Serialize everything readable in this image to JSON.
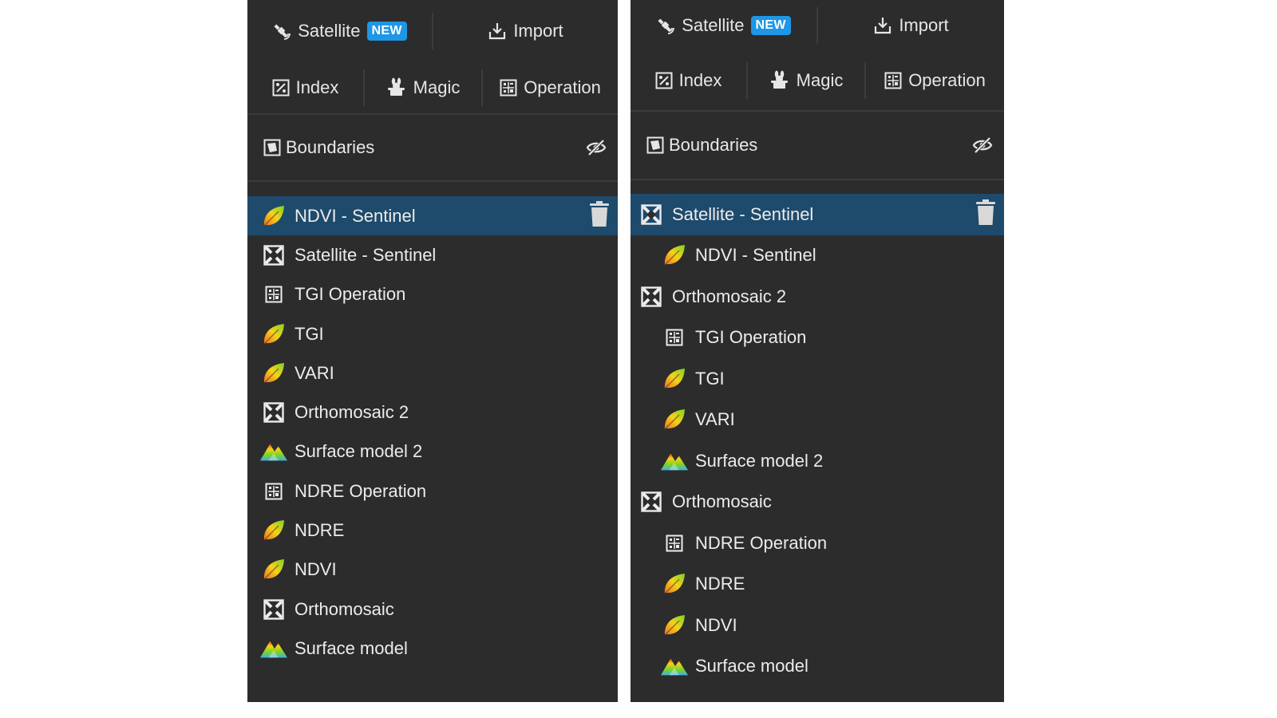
{
  "toolbar": {
    "satellite_label": "Satellite",
    "new_badge": "NEW",
    "import_label": "Import",
    "index_label": "Index",
    "magic_label": "Magic",
    "operation_label": "Operation"
  },
  "boundaries_label": "Boundaries",
  "left_layers": [
    {
      "label": "NDVI - Sentinel",
      "icon": "leaf-icon",
      "selected": true
    },
    {
      "label": "Satellite - Sentinel",
      "icon": "imagery-icon"
    },
    {
      "label": "TGI Operation",
      "icon": "operation-icon"
    },
    {
      "label": "TGI",
      "icon": "leaf-icon"
    },
    {
      "label": "VARI",
      "icon": "leaf-icon"
    },
    {
      "label": "Orthomosaic 2",
      "icon": "imagery-icon"
    },
    {
      "label": "Surface model 2",
      "icon": "mountain-icon"
    },
    {
      "label": "NDRE Operation",
      "icon": "operation-icon"
    },
    {
      "label": "NDRE",
      "icon": "leaf-icon"
    },
    {
      "label": "NDVI",
      "icon": "leaf-icon"
    },
    {
      "label": "Orthomosaic",
      "icon": "imagery-icon"
    },
    {
      "label": "Surface model",
      "icon": "mountain-icon"
    }
  ],
  "right_layers": [
    {
      "label": "Satellite - Sentinel",
      "icon": "imagery-icon",
      "level": 0,
      "selected": true
    },
    {
      "label": "NDVI - Sentinel",
      "icon": "leaf-icon",
      "level": 1
    },
    {
      "label": "Orthomosaic 2",
      "icon": "imagery-icon",
      "level": 0
    },
    {
      "label": "TGI Operation",
      "icon": "operation-icon",
      "level": 1
    },
    {
      "label": "TGI",
      "icon": "leaf-icon",
      "level": 1
    },
    {
      "label": "VARI",
      "icon": "leaf-icon",
      "level": 1
    },
    {
      "label": "Surface model 2",
      "icon": "mountain-icon",
      "level": 1
    },
    {
      "label": "Orthomosaic",
      "icon": "imagery-icon",
      "level": 0
    },
    {
      "label": "NDRE Operation",
      "icon": "operation-icon",
      "level": 1
    },
    {
      "label": "NDRE",
      "icon": "leaf-icon",
      "level": 1
    },
    {
      "label": "NDVI",
      "icon": "leaf-icon",
      "level": 1
    },
    {
      "label": "Surface model",
      "icon": "mountain-icon",
      "level": 1
    }
  ],
  "colors": {
    "panel_bg": "#2c2c2c",
    "selected_row": "#1e4a6c",
    "badge": "#1f96e6",
    "text": "#e9e9e9"
  }
}
